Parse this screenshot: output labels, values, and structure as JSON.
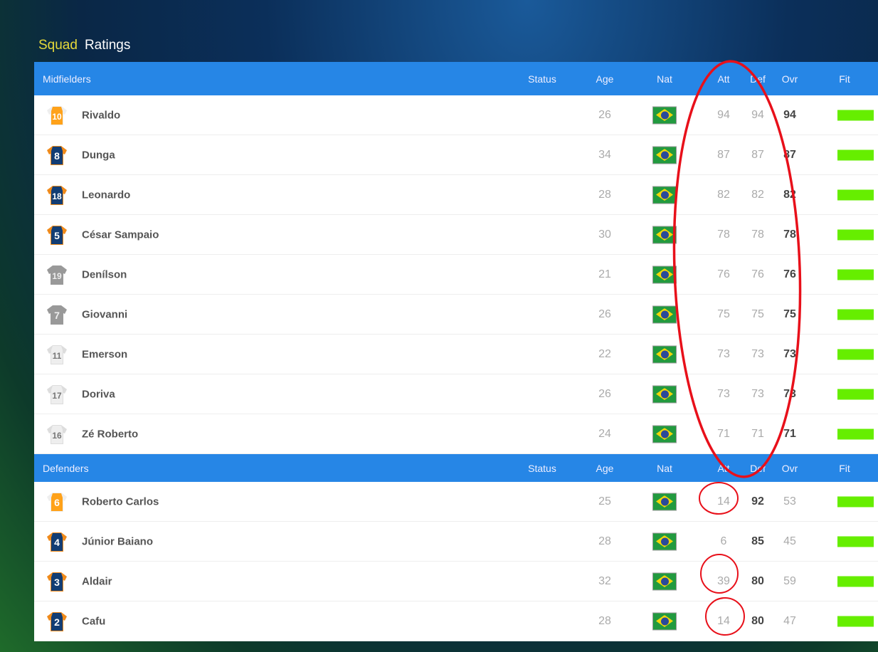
{
  "title": {
    "squad": "Squad",
    "ratings": "Ratings"
  },
  "columns": {
    "status": "Status",
    "age": "Age",
    "nat": "Nat",
    "att": "Att",
    "def": "Def",
    "ovr": "Ovr",
    "fit": "Fit"
  },
  "colors": {
    "header": "#2686e6",
    "fit": "#66ee00",
    "annotation": "#e8101a"
  },
  "groups": [
    {
      "name": "Midfielders",
      "bold": "ovr",
      "players": [
        {
          "num": "10",
          "shirt": "orange",
          "name": "Rivaldo",
          "age": "26",
          "att": "94",
          "def": "94",
          "ovr": "94",
          "fit": 100
        },
        {
          "num": "8",
          "shirt": "navy",
          "name": "Dunga",
          "age": "34",
          "att": "87",
          "def": "87",
          "ovr": "87",
          "fit": 100
        },
        {
          "num": "18",
          "shirt": "navy",
          "name": "Leonardo",
          "age": "28",
          "att": "82",
          "def": "82",
          "ovr": "82",
          "fit": 100
        },
        {
          "num": "5",
          "shirt": "navy",
          "name": "César Sampaio",
          "age": "30",
          "att": "78",
          "def": "78",
          "ovr": "78",
          "fit": 100
        },
        {
          "num": "19",
          "shirt": "gray",
          "name": "Denílson",
          "age": "21",
          "att": "76",
          "def": "76",
          "ovr": "76",
          "fit": 100
        },
        {
          "num": "7",
          "shirt": "gray",
          "name": "Giovanni",
          "age": "26",
          "att": "75",
          "def": "75",
          "ovr": "75",
          "fit": 100
        },
        {
          "num": "11",
          "shirt": "white",
          "name": "Emerson",
          "age": "22",
          "att": "73",
          "def": "73",
          "ovr": "73",
          "fit": 100
        },
        {
          "num": "17",
          "shirt": "white",
          "name": "Doriva",
          "age": "26",
          "att": "73",
          "def": "73",
          "ovr": "73",
          "fit": 100
        },
        {
          "num": "16",
          "shirt": "white",
          "name": "Zé Roberto",
          "age": "24",
          "att": "71",
          "def": "71",
          "ovr": "71",
          "fit": 100
        }
      ]
    },
    {
      "name": "Defenders",
      "bold": "def",
      "players": [
        {
          "num": "6",
          "shirt": "orange",
          "name": "Roberto Carlos",
          "age": "25",
          "att": "14",
          "def": "92",
          "ovr": "53",
          "fit": 100
        },
        {
          "num": "4",
          "shirt": "navy",
          "name": "Júnior Baiano",
          "age": "28",
          "att": "6",
          "def": "85",
          "ovr": "45",
          "fit": 100
        },
        {
          "num": "3",
          "shirt": "navy",
          "name": "Aldair",
          "age": "32",
          "att": "39",
          "def": "80",
          "ovr": "59",
          "fit": 100
        },
        {
          "num": "2",
          "shirt": "navy",
          "name": "Cafu",
          "age": "28",
          "att": "14",
          "def": "80",
          "ovr": "47",
          "fit": 100
        }
      ]
    }
  ]
}
